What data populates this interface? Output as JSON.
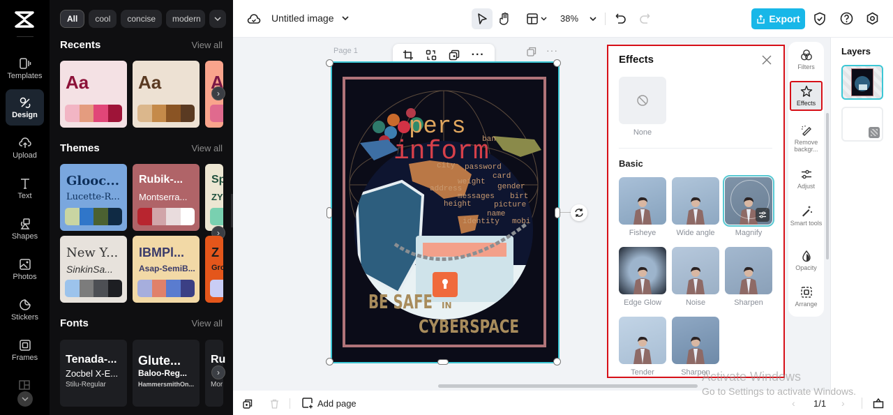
{
  "rail": {
    "items": [
      {
        "label": "Templates",
        "icon": "templates-icon"
      },
      {
        "label": "Design",
        "icon": "design-icon",
        "active": true
      },
      {
        "label": "Upload",
        "icon": "upload-icon"
      },
      {
        "label": "Text",
        "icon": "text-icon"
      },
      {
        "label": "Shapes",
        "icon": "shapes-icon"
      },
      {
        "label": "Photos",
        "icon": "photos-icon"
      },
      {
        "label": "Stickers",
        "icon": "stickers-icon"
      },
      {
        "label": "Frames",
        "icon": "frames-icon"
      }
    ]
  },
  "design": {
    "chips": [
      "All",
      "cool",
      "concise",
      "modern"
    ],
    "recents": {
      "title": "Recents",
      "view_all": "View all",
      "cards": [
        {
          "aa": "Aa",
          "bg": "#f4e1e4",
          "fg": "#8c1239",
          "swatches": [
            "#f2b5c4",
            "#e49c7f",
            "#e14678",
            "#9e1438"
          ]
        },
        {
          "aa": "Aa",
          "bg": "#ede1d3",
          "fg": "#5a3a22",
          "swatches": [
            "#dbb78c",
            "#c58a4a",
            "#8a5424",
            "#5a3a22"
          ]
        },
        {
          "aa": "A",
          "bg": "#f9a48c",
          "fg": "#7a1745",
          "swatches": [
            "#e06a8e"
          ]
        }
      ]
    },
    "themes": {
      "title": "Themes",
      "view_all": "View all",
      "cards": [
        {
          "t1": "Glooc...",
          "t2": "Lucette-R...",
          "bg": "#7aa7de",
          "fg": "#0d2f5a",
          "swatches": [
            "#c9d5a2",
            "#3076c9",
            "#4b6131",
            "#0f2a44"
          ]
        },
        {
          "t1": "Rubik-...",
          "t2": "Montserra...",
          "bg": "#b06468",
          "fg": "#ffffff",
          "swatches": [
            "#b8252f",
            "#d1a5a9",
            "#e9dcdd",
            "#ffffff"
          ]
        },
        {
          "t1": "Sp",
          "t2": "ZY",
          "bg": "#ece6d2",
          "fg": "#1f4f3c",
          "swatches": [
            "#79d0b0"
          ]
        },
        {
          "t1": "New Y...",
          "t2": "SinkinSa...",
          "bg": "#e7e2dc",
          "fg": "#333333",
          "swatches": [
            "#9cc3ec",
            "#7c7c7c",
            "#4d4f54",
            "#1d1e22"
          ]
        },
        {
          "t1": "IBMPl...",
          "t2": "Asap-SemiB...",
          "bg": "#f2d9a6",
          "fg": "#3a3b6a",
          "swatches": [
            "#a6aedd",
            "#e0816a",
            "#5a7ccf",
            "#3b3f84"
          ]
        },
        {
          "t1": "Z",
          "t2": "Gro",
          "bg": "#e4561b",
          "fg": "#1d1d1d",
          "swatches": [
            "#c9cdf5"
          ]
        }
      ]
    },
    "fonts": {
      "title": "Fonts",
      "view_all": "View all",
      "cards": [
        {
          "f1": "Tenada-...",
          "f2": "Zocbel X-E...",
          "f3": "Stilu-Regular"
        },
        {
          "f1": "Glute...",
          "f2": "Baloo-Reg...",
          "f3": "HammersmithOn..."
        },
        {
          "f1": "Ru",
          "f2": "",
          "f3": "Mor"
        }
      ]
    }
  },
  "topbar": {
    "title": "Untitled image",
    "zoom": "38%",
    "export": "Export"
  },
  "canvas": {
    "page_label": "Page 1",
    "poster": {
      "heading_line1": "pers",
      "heading_line2": "inform",
      "words": [
        "city",
        "password",
        "card",
        "weight",
        "gender",
        "address",
        "messages",
        "birt",
        "height",
        "picture",
        "name",
        "identity",
        "mobi",
        "ban"
      ],
      "tagline1": "BE SAFE",
      "tagline_in": "IN",
      "tagline2": "CYBERSPACE"
    }
  },
  "bottombar": {
    "add_page": "Add page",
    "page_counter": "1/1"
  },
  "effects": {
    "title": "Effects",
    "none_label": "None",
    "section": "Basic",
    "items": [
      {
        "label": "Fisheye"
      },
      {
        "label": "Wide angle"
      },
      {
        "label": "Magnify",
        "selected": true
      },
      {
        "label": "Edge Glow"
      },
      {
        "label": "Noise"
      },
      {
        "label": "Sharpen"
      },
      {
        "label": "Tender"
      },
      {
        "label": "Sharpen"
      }
    ]
  },
  "properties": {
    "items": [
      {
        "label": "Filters"
      },
      {
        "label": "Effects",
        "active": true
      },
      {
        "label": "Remove backgr..."
      },
      {
        "label": "Adjust"
      },
      {
        "label": "Smart tools"
      },
      {
        "label": "Opacity"
      },
      {
        "label": "Arrange"
      }
    ]
  },
  "layers": {
    "title": "Layers"
  },
  "watermark": {
    "line1": "Activate Windows",
    "line2": "Go to Settings to activate Windows."
  },
  "colors": {
    "accent": "#18b7e8",
    "selection": "#3cc7d5",
    "highlight": "#d60f17"
  }
}
